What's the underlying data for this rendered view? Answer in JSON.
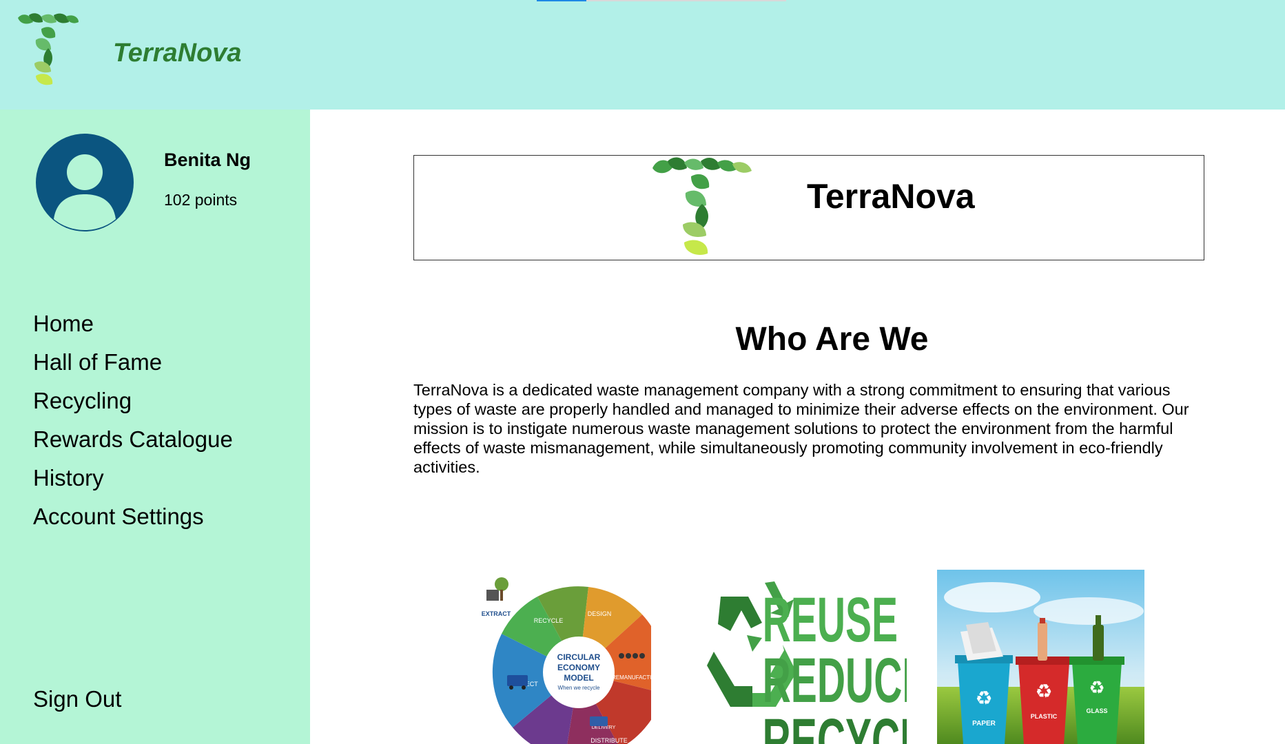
{
  "header": {
    "brand": "TerraNova",
    "logo_icon": "leaf-t-logo-icon"
  },
  "user": {
    "name": "Benita Ng",
    "points": "102 points",
    "avatar_icon": "user-avatar-icon"
  },
  "nav": {
    "items": [
      {
        "label": "Home"
      },
      {
        "label": "Hall of Fame"
      },
      {
        "label": "Recycling"
      },
      {
        "label": "Rewards Catalogue"
      },
      {
        "label": "History"
      },
      {
        "label": "Account Settings"
      }
    ],
    "signout": "Sign Out"
  },
  "main": {
    "banner_title": "TerraNova",
    "section_title": "Who Are We",
    "intro": "TerraNova is a dedicated waste management company with a strong commitment to ensuring that various types of waste are properly handled and managed to minimize their adverse effects on the environment. Our mission is to instigate numerous waste management solutions to protect the environment from the harmful effects of waste mismanagement, while simultaneously promoting community involvement in eco-friendly activities."
  },
  "images": {
    "circular": {
      "center_lines": [
        "CIRCULAR",
        "ECONOMY",
        "MODEL"
      ],
      "center_sub": "When we recycle",
      "segments": [
        "EXTRACT",
        "RECYCLE",
        "DESIGN",
        "REMANUFACTURE",
        "COLLECT",
        "DISTRIBUTE",
        "DELIVERY"
      ]
    },
    "rrr": {
      "words": [
        "REUSE",
        "REDUCE",
        "RECYCLE"
      ]
    },
    "bins": {
      "labels": [
        "PAPER",
        "PLASTIC",
        "GLASS"
      ]
    }
  },
  "colors": {
    "header_bg": "#b2f0e8",
    "sidebar_bg": "#b4f5d6",
    "brand_green": "#2e7d32",
    "avatar_blue": "#0b5580"
  }
}
